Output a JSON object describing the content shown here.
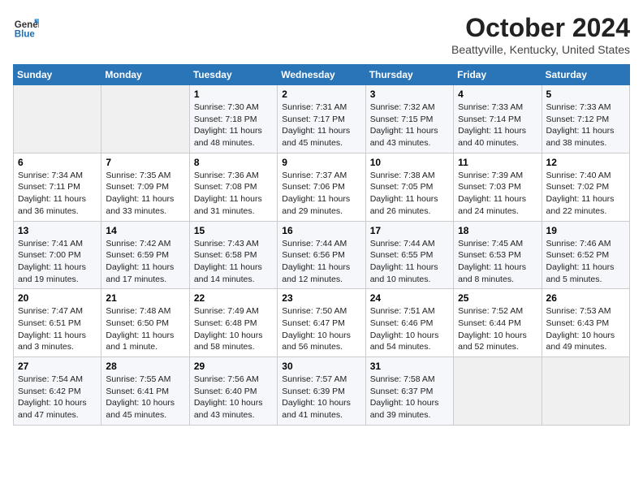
{
  "header": {
    "logo_line1": "General",
    "logo_line2": "Blue",
    "title": "October 2024",
    "subtitle": "Beattyville, Kentucky, United States"
  },
  "weekdays": [
    "Sunday",
    "Monday",
    "Tuesday",
    "Wednesday",
    "Thursday",
    "Friday",
    "Saturday"
  ],
  "weeks": [
    [
      {
        "day": "",
        "detail": ""
      },
      {
        "day": "",
        "detail": ""
      },
      {
        "day": "1",
        "detail": "Sunrise: 7:30 AM\nSunset: 7:18 PM\nDaylight: 11 hours\nand 48 minutes."
      },
      {
        "day": "2",
        "detail": "Sunrise: 7:31 AM\nSunset: 7:17 PM\nDaylight: 11 hours\nand 45 minutes."
      },
      {
        "day": "3",
        "detail": "Sunrise: 7:32 AM\nSunset: 7:15 PM\nDaylight: 11 hours\nand 43 minutes."
      },
      {
        "day": "4",
        "detail": "Sunrise: 7:33 AM\nSunset: 7:14 PM\nDaylight: 11 hours\nand 40 minutes."
      },
      {
        "day": "5",
        "detail": "Sunrise: 7:33 AM\nSunset: 7:12 PM\nDaylight: 11 hours\nand 38 minutes."
      }
    ],
    [
      {
        "day": "6",
        "detail": "Sunrise: 7:34 AM\nSunset: 7:11 PM\nDaylight: 11 hours\nand 36 minutes."
      },
      {
        "day": "7",
        "detail": "Sunrise: 7:35 AM\nSunset: 7:09 PM\nDaylight: 11 hours\nand 33 minutes."
      },
      {
        "day": "8",
        "detail": "Sunrise: 7:36 AM\nSunset: 7:08 PM\nDaylight: 11 hours\nand 31 minutes."
      },
      {
        "day": "9",
        "detail": "Sunrise: 7:37 AM\nSunset: 7:06 PM\nDaylight: 11 hours\nand 29 minutes."
      },
      {
        "day": "10",
        "detail": "Sunrise: 7:38 AM\nSunset: 7:05 PM\nDaylight: 11 hours\nand 26 minutes."
      },
      {
        "day": "11",
        "detail": "Sunrise: 7:39 AM\nSunset: 7:03 PM\nDaylight: 11 hours\nand 24 minutes."
      },
      {
        "day": "12",
        "detail": "Sunrise: 7:40 AM\nSunset: 7:02 PM\nDaylight: 11 hours\nand 22 minutes."
      }
    ],
    [
      {
        "day": "13",
        "detail": "Sunrise: 7:41 AM\nSunset: 7:00 PM\nDaylight: 11 hours\nand 19 minutes."
      },
      {
        "day": "14",
        "detail": "Sunrise: 7:42 AM\nSunset: 6:59 PM\nDaylight: 11 hours\nand 17 minutes."
      },
      {
        "day": "15",
        "detail": "Sunrise: 7:43 AM\nSunset: 6:58 PM\nDaylight: 11 hours\nand 14 minutes."
      },
      {
        "day": "16",
        "detail": "Sunrise: 7:44 AM\nSunset: 6:56 PM\nDaylight: 11 hours\nand 12 minutes."
      },
      {
        "day": "17",
        "detail": "Sunrise: 7:44 AM\nSunset: 6:55 PM\nDaylight: 11 hours\nand 10 minutes."
      },
      {
        "day": "18",
        "detail": "Sunrise: 7:45 AM\nSunset: 6:53 PM\nDaylight: 11 hours\nand 8 minutes."
      },
      {
        "day": "19",
        "detail": "Sunrise: 7:46 AM\nSunset: 6:52 PM\nDaylight: 11 hours\nand 5 minutes."
      }
    ],
    [
      {
        "day": "20",
        "detail": "Sunrise: 7:47 AM\nSunset: 6:51 PM\nDaylight: 11 hours\nand 3 minutes."
      },
      {
        "day": "21",
        "detail": "Sunrise: 7:48 AM\nSunset: 6:50 PM\nDaylight: 11 hours\nand 1 minute."
      },
      {
        "day": "22",
        "detail": "Sunrise: 7:49 AM\nSunset: 6:48 PM\nDaylight: 10 hours\nand 58 minutes."
      },
      {
        "day": "23",
        "detail": "Sunrise: 7:50 AM\nSunset: 6:47 PM\nDaylight: 10 hours\nand 56 minutes."
      },
      {
        "day": "24",
        "detail": "Sunrise: 7:51 AM\nSunset: 6:46 PM\nDaylight: 10 hours\nand 54 minutes."
      },
      {
        "day": "25",
        "detail": "Sunrise: 7:52 AM\nSunset: 6:44 PM\nDaylight: 10 hours\nand 52 minutes."
      },
      {
        "day": "26",
        "detail": "Sunrise: 7:53 AM\nSunset: 6:43 PM\nDaylight: 10 hours\nand 49 minutes."
      }
    ],
    [
      {
        "day": "27",
        "detail": "Sunrise: 7:54 AM\nSunset: 6:42 PM\nDaylight: 10 hours\nand 47 minutes."
      },
      {
        "day": "28",
        "detail": "Sunrise: 7:55 AM\nSunset: 6:41 PM\nDaylight: 10 hours\nand 45 minutes."
      },
      {
        "day": "29",
        "detail": "Sunrise: 7:56 AM\nSunset: 6:40 PM\nDaylight: 10 hours\nand 43 minutes."
      },
      {
        "day": "30",
        "detail": "Sunrise: 7:57 AM\nSunset: 6:39 PM\nDaylight: 10 hours\nand 41 minutes."
      },
      {
        "day": "31",
        "detail": "Sunrise: 7:58 AM\nSunset: 6:37 PM\nDaylight: 10 hours\nand 39 minutes."
      },
      {
        "day": "",
        "detail": ""
      },
      {
        "day": "",
        "detail": ""
      }
    ]
  ]
}
